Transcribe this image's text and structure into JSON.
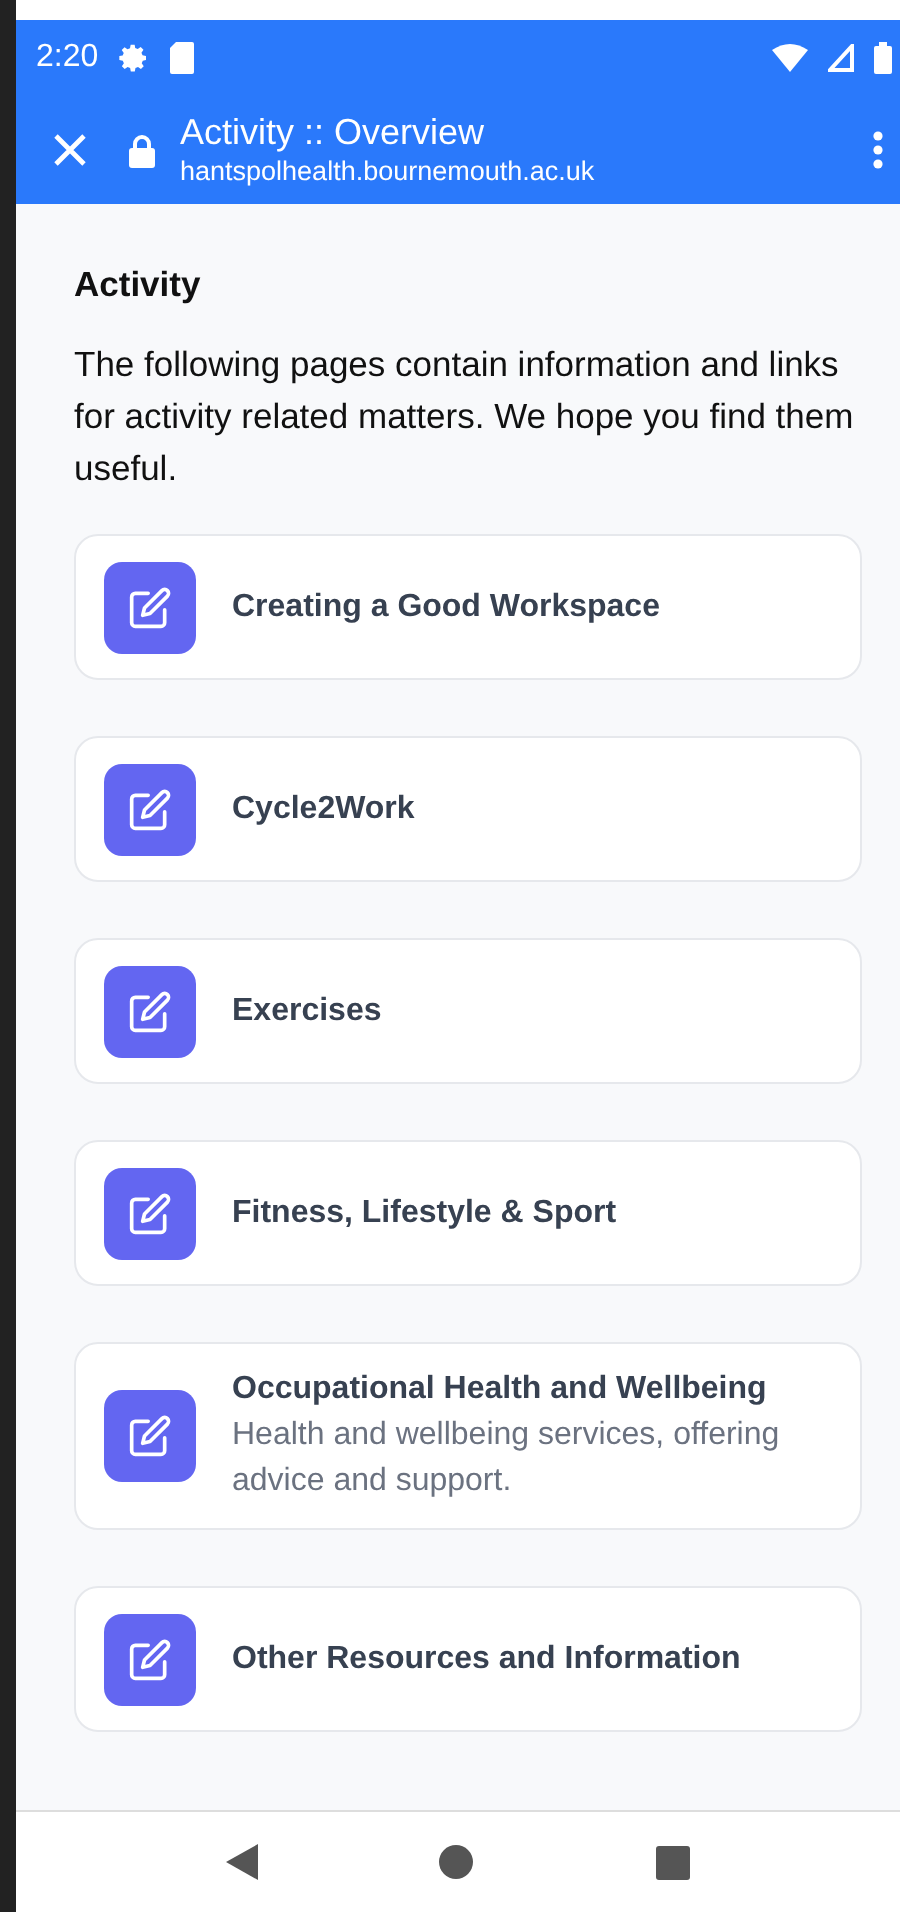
{
  "status_bar": {
    "time": "2:20"
  },
  "toolbar": {
    "title": "Activity :: Overview",
    "url": "hantspolhealth.bournemouth.ac.uk"
  },
  "page": {
    "heading": "Activity",
    "intro": "The following pages contain information and links for activity related matters. We hope you find them useful.",
    "items": [
      {
        "title": "Creating a Good Workspace"
      },
      {
        "title": "Cycle2Work"
      },
      {
        "title": "Exercises"
      },
      {
        "title": "Fitness, Lifestyle & Sport"
      },
      {
        "title": "Occupational Health and Wellbeing",
        "description": "Health and wellbeing services, offering advice and support."
      },
      {
        "title": "Other Resources and Information"
      }
    ]
  }
}
